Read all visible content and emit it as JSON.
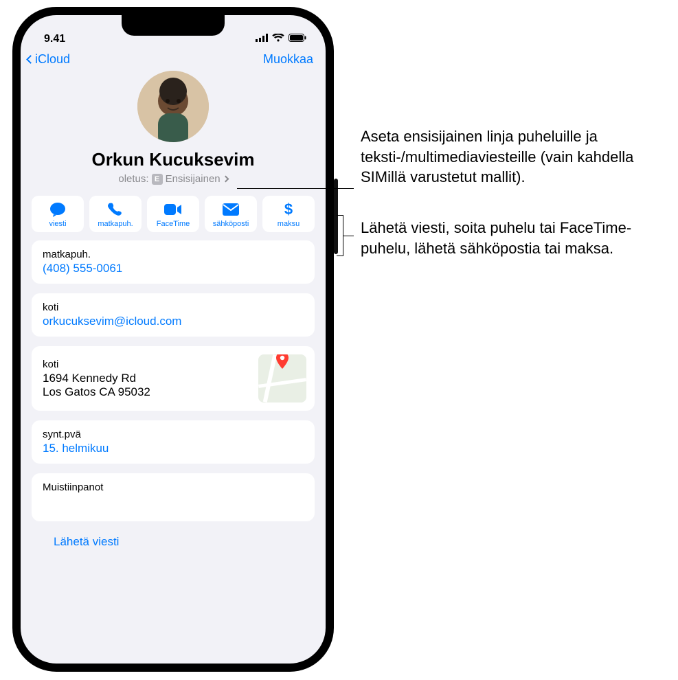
{
  "status": {
    "time": "9.41"
  },
  "nav": {
    "back_label": "iCloud",
    "edit_label": "Muokkaa"
  },
  "contact": {
    "name": "Orkun Kucuksevim",
    "default_prefix": "oletus:",
    "sim_letter": "E",
    "default_line": "Ensisijainen"
  },
  "actions": {
    "message": "viesti",
    "call": "matkapuh.",
    "facetime": "FaceTime",
    "mail": "sähköposti",
    "pay": "maksu"
  },
  "fields": {
    "phone_label": "matkapuh.",
    "phone_value": "(408) 555-0061",
    "email_label": "koti",
    "email_value": "orkucuksevim@icloud.com",
    "address_label": "koti",
    "address_line1": "1694 Kennedy Rd",
    "address_line2": "Los Gatos CA 95032",
    "birthday_label": "synt.pvä",
    "birthday_value": "15. helmikuu",
    "notes_label": "Muistiinpanot",
    "send_message": "Lähetä viesti"
  },
  "callouts": {
    "sim": "Aseta ensisijainen linja puheluille ja teksti-/multimediaviesteille (vain kahdella SIMillä varustetut mallit).",
    "actions": "Lähetä viesti, soita puhelu tai FaceTime-puhelu, lähetä sähköpostia tai maksa."
  }
}
